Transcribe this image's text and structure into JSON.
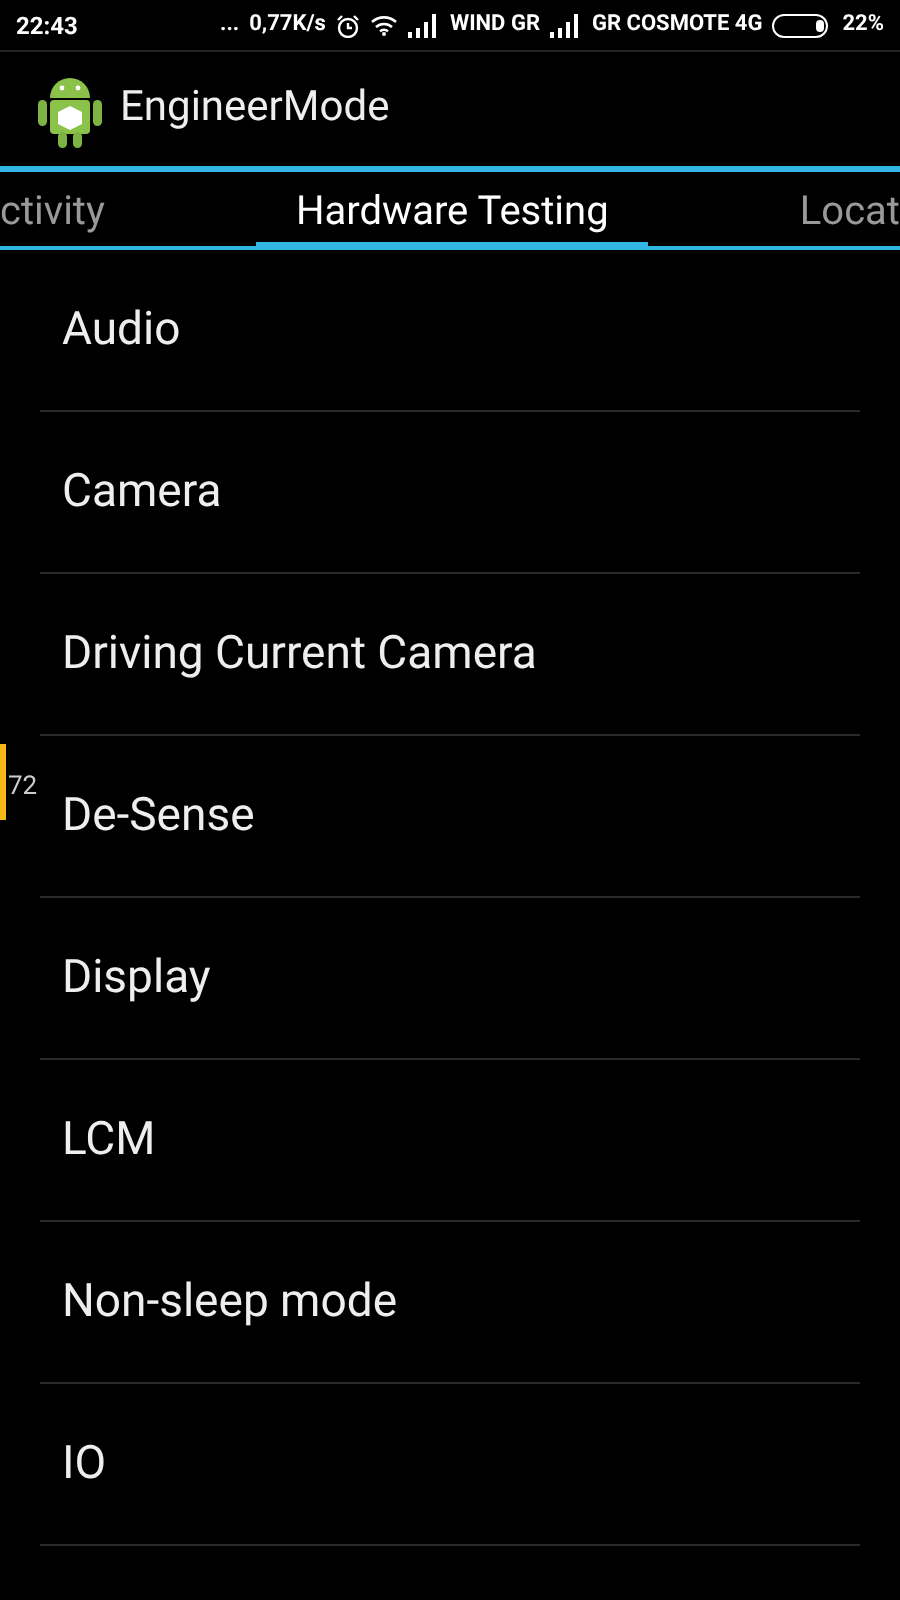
{
  "status_bar": {
    "time": "22:43",
    "dots": "...",
    "speed": "0,77K/s",
    "carrier_1": "WIND GR",
    "carrier_2": "GR COSMOTE 4G",
    "battery": "22%"
  },
  "app_bar": {
    "title": "EngineerMode"
  },
  "tabs": [
    {
      "label": "ctivity",
      "selected": false
    },
    {
      "label": "Hardware Testing",
      "selected": true
    },
    {
      "label": "Locat",
      "selected": false
    }
  ],
  "items": [
    {
      "label": "Audio"
    },
    {
      "label": "Camera"
    },
    {
      "label": "Driving Current Camera"
    },
    {
      "label": "De-Sense"
    },
    {
      "label": "Display"
    },
    {
      "label": "LCM"
    },
    {
      "label": "Non-sleep mode"
    },
    {
      "label": "IO"
    }
  ],
  "side_indicator": {
    "value": "72"
  }
}
